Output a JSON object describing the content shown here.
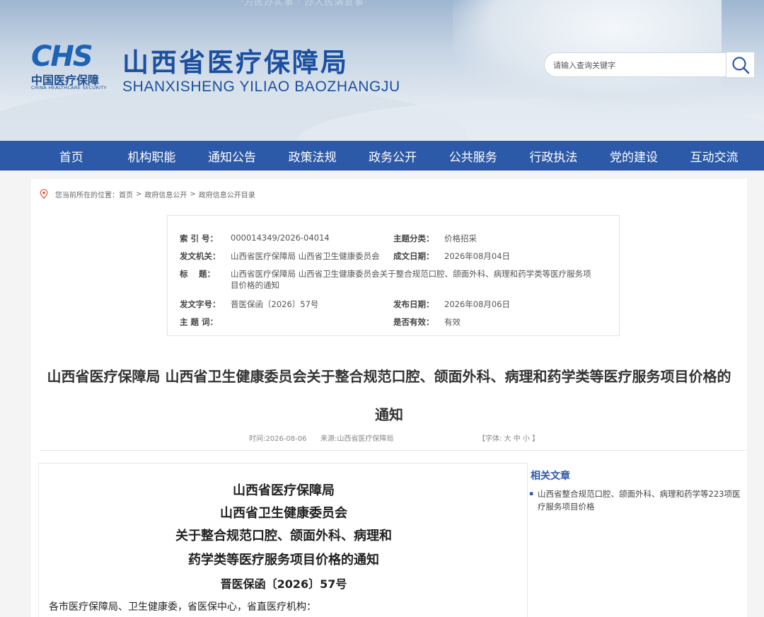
{
  "header": {
    "slogan": "·为民办实事 · 办人民满意事·",
    "logo_mark": "CHS",
    "logo_cn": "中国医疗保障",
    "logo_en": "CHINA HEALTHCARE SECURITY",
    "site_title": "山西省医疗保障局",
    "site_subtitle": "SHANXISHENG YILIAO BAOZHANGJU",
    "search_placeholder": "请输入查询关键字"
  },
  "nav": [
    "首页",
    "机构职能",
    "通知公告",
    "政策法规",
    "政务公开",
    "公共服务",
    "行政执法",
    "党的建设",
    "互动交流"
  ],
  "breadcrumb": {
    "prefix": "您当前所在的位置：",
    "items": [
      "首页",
      "政府信息公开",
      "政府信息公开目录"
    ],
    "sep": ">"
  },
  "meta": {
    "index_label": "索 引 号：",
    "index_value": "000014349/2026-04014",
    "category_label": "主题分类：",
    "category_value": "价格招采",
    "issuer_label": "发文机关：",
    "issuer_value": "山西省医疗保障局 山西省卫生健康委员会",
    "created_label": "成文日期：",
    "created_value": "2026年08月04日",
    "title_label": "标　 题：",
    "title_value_line1": "山西省医疗保障局 山西省卫生健康委员会关于整合规范口腔、颌面外科、病理和药学类等医疗服务项",
    "title_value_line2": "目价格的通知",
    "docno_label": "发文字号：",
    "docno_value": "晋医保函〔2026〕57号",
    "published_label": "发布日期：",
    "published_value": "2026年08月06日",
    "keywords_label": "主 题 词：",
    "keywords_value": "",
    "valid_label": "是否有效：",
    "valid_value": "有效"
  },
  "article": {
    "title_line1": "山西省医疗保障局 山西省卫生健康委员会关于整合规范口腔、颌面外科、病理和药学类等医疗服务项目价格的",
    "title_line2": "通知",
    "time": "时间:2026-08-06",
    "source": "来源:山西省医疗保障局",
    "font_size": "【字体: 大 中 小 】"
  },
  "doc": {
    "h1": "山西省医疗保障局",
    "h2": "山西省卫生健康委员会",
    "h3": "关于整合规范口腔、颌面外科、病理和",
    "h4": "药学类等医疗服务项目价格的通知",
    "number": "晋医保函〔2026〕57号",
    "salutation": "各市医疗保障局、卫生健康委，省医保中心，省直医疗机构："
  },
  "related": {
    "title": "相关文章",
    "items": [
      "山西省整合规范口腔、颌面外科、病理和药学等223项医疗服务项目价格"
    ]
  }
}
